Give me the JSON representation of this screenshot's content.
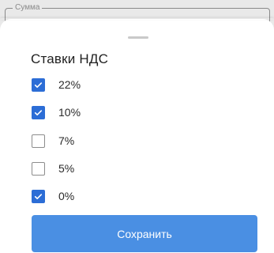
{
  "background": {
    "field_label": "Сумма"
  },
  "sheet": {
    "title": "Ставки НДС",
    "options": [
      {
        "label": "22%",
        "checked": true
      },
      {
        "label": "10%",
        "checked": true
      },
      {
        "label": "7%",
        "checked": false
      },
      {
        "label": "5%",
        "checked": false
      },
      {
        "label": "0%",
        "checked": true
      }
    ],
    "save_label": "Сохранить"
  },
  "colors": {
    "accent": "#2c6dd6",
    "button": "#4a8fe3",
    "backdrop": "#e9e9e9"
  }
}
